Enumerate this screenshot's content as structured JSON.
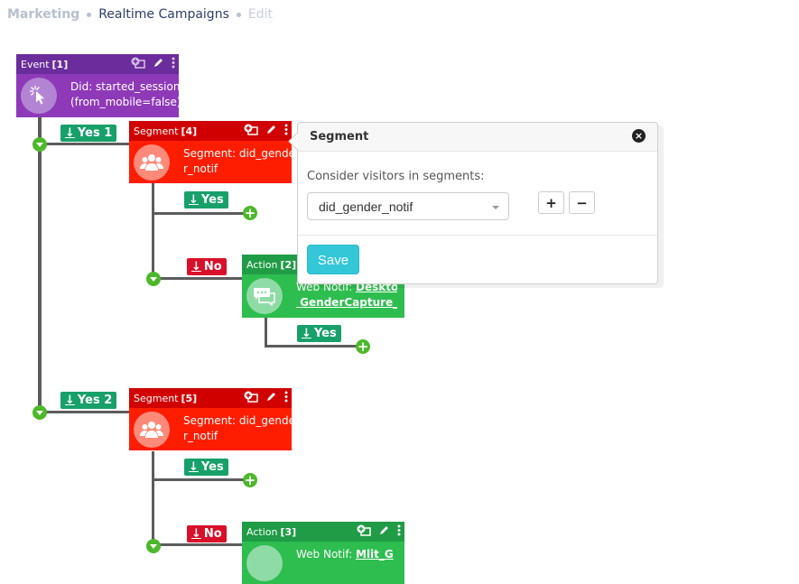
{
  "breadcrumb": {
    "items": [
      {
        "label": "Marketing"
      },
      {
        "label": "Realtime Campaigns"
      },
      {
        "label": "Edit"
      }
    ]
  },
  "nodes": {
    "event1": {
      "type": "Event",
      "id": "[1]",
      "line1": "Did: started_session",
      "line2": "(from_mobile=false)",
      "icon": "pointer-click-icon"
    },
    "segment4": {
      "type": "Segment",
      "id": "[4]",
      "line1": "Segment: did_gende",
      "line2": "r_notif",
      "icon": "users-icon"
    },
    "action2": {
      "type": "Action",
      "id": "[2]",
      "prefix": "Web Notif: ",
      "link1": "Desktop",
      "link2": " GenderCapture_Vi",
      "icon": "chat-icon"
    },
    "segment5": {
      "type": "Segment",
      "id": "[5]",
      "line1": "Segment: did_gende",
      "line2": "r_notif",
      "icon": "users-icon"
    },
    "action3": {
      "type": "Action",
      "id": "[3]",
      "prefix": "Web Notif: ",
      "link1": "Mlit_G",
      "icon": "chat-icon"
    }
  },
  "branches": {
    "yes1": "Yes 1",
    "yes2": "Yes 2",
    "yes": "Yes",
    "no": "No",
    "arrow": "↓"
  },
  "popover": {
    "title": "Segment",
    "label": "Consider visitors in segments:",
    "selected_segment": "did_gender_notif",
    "add_label": "+",
    "remove_label": "−",
    "save_label": "Save"
  },
  "colors": {
    "event": "#8e3ab8",
    "segment": "#ff1d00",
    "action": "#2ebd4f",
    "yes_badge": "#17a06a",
    "no_badge": "#d9102a",
    "save": "#33c7d8"
  }
}
